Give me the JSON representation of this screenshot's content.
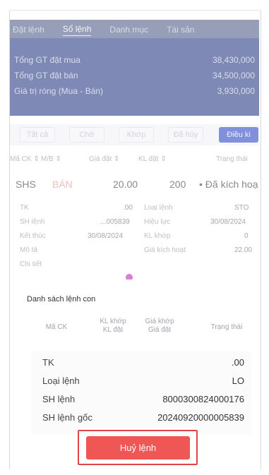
{
  "tabs": [
    {
      "label": "Đặt lệnh"
    },
    {
      "label": "Sổ lệnh",
      "active": true
    },
    {
      "label": "Danh mục"
    },
    {
      "label": "Tài sản"
    }
  ],
  "summary": [
    {
      "label": "Tổng GT đặt mua",
      "value": "38,430,000"
    },
    {
      "label": "Tổng GT đặt bán",
      "value": "34,500,000"
    },
    {
      "label": "Giá trị ròng (Mua - Bán)",
      "value": "3,930,000"
    }
  ],
  "filters": [
    {
      "label": "Tất cả"
    },
    {
      "label": "Chờ"
    },
    {
      "label": "Khớp"
    },
    {
      "label": "Đã hủy"
    },
    {
      "label": "Điều ki",
      "active": true
    }
  ],
  "columns": [
    "Mã CK ⇕",
    "M/B ⇕",
    "Giá đặt ⇕",
    "KL đặt ⇕",
    "Trạng thái"
  ],
  "order": {
    "symbol": "SHS",
    "side": "BÁN",
    "price": "20.00",
    "quantity": "200",
    "status": "• Đã kích hoạ"
  },
  "detail": {
    "tk_label": "TK",
    "tk_value": ".00",
    "order_type_label": "Loại lệnh",
    "order_type_value": "STO",
    "order_no_label": "SH lệnh",
    "order_no_value": "...005839",
    "valid_label": "Hiệu lực",
    "valid_value": "30/08/2024",
    "end_label": "Kết thúc",
    "end_value": "30/08/2024",
    "matched_qty_label": "KL khớp",
    "matched_qty_value": "0",
    "desc_label": "Mô tả",
    "trigger_label": "Giá kích hoạt",
    "trigger_value": "22.00",
    "more_label": "Chi tiết"
  },
  "sheet": {
    "title": "Danh sách lệnh con",
    "col_symbol": "Mã CK",
    "col_qty_top": "KL khớp",
    "col_qty_bottom": "KL đặt",
    "col_price_top": "Giá khớp",
    "col_price_bottom": "Giá đặt",
    "col_status": "Trạng thái",
    "rows": [
      {
        "label": "TK",
        "value": ".00"
      },
      {
        "label": "Loại lệnh",
        "value": "LO"
      },
      {
        "label": "SH lệnh",
        "value": "8000300824000176"
      },
      {
        "label": "SH lệnh gốc",
        "value": "20240920000005839"
      }
    ],
    "cancel_label": "Huỷ lệnh"
  },
  "colors": {
    "accent": "#3d55c6",
    "header": "#3a4a8e",
    "danger": "#ef5656"
  }
}
